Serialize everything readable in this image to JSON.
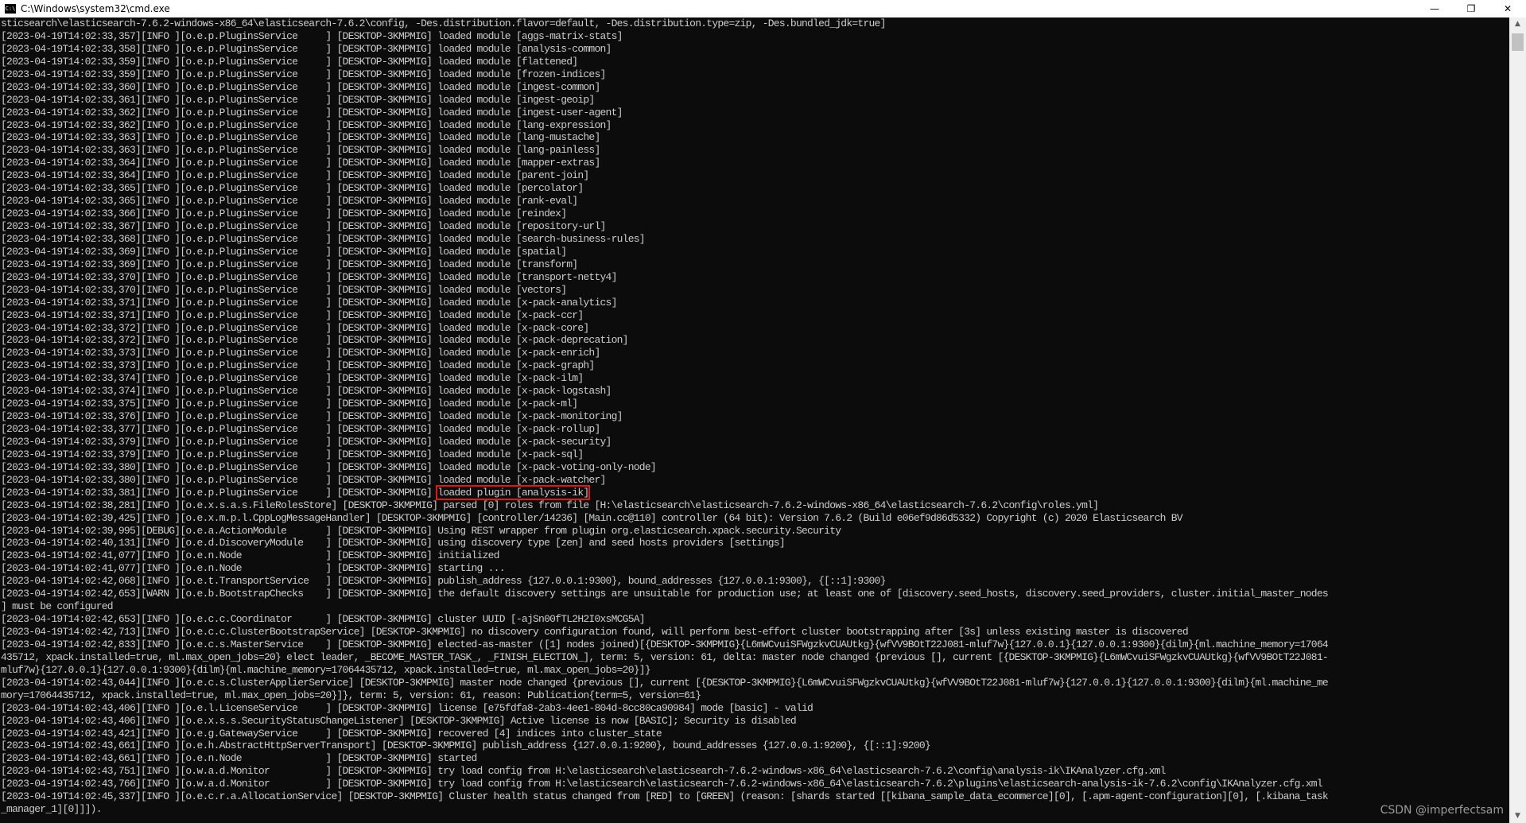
{
  "window": {
    "title": "C:\\Windows\\system32\\cmd.exe",
    "icon": "C:\\",
    "buttons": {
      "minimize": "—",
      "restore": "❐",
      "close": "✕"
    }
  },
  "console": {
    "highlight_text": "loaded plugin [analysis-ik]",
    "lines": [
      "sticsearch\\elasticsearch-7.6.2-windows-x86_64\\elasticsearch-7.6.2\\config, -Des.distribution.flavor=default, -Des.distribution.type=zip, -Des.bundled_jdk=true]",
      "[2023-04-19T14:02:33,357][INFO ][o.e.p.PluginsService     ] [DESKTOP-3KMPMIG] loaded module [aggs-matrix-stats]",
      "[2023-04-19T14:02:33,358][INFO ][o.e.p.PluginsService     ] [DESKTOP-3KMPMIG] loaded module [analysis-common]",
      "[2023-04-19T14:02:33,359][INFO ][o.e.p.PluginsService     ] [DESKTOP-3KMPMIG] loaded module [flattened]",
      "[2023-04-19T14:02:33,359][INFO ][o.e.p.PluginsService     ] [DESKTOP-3KMPMIG] loaded module [frozen-indices]",
      "[2023-04-19T14:02:33,360][INFO ][o.e.p.PluginsService     ] [DESKTOP-3KMPMIG] loaded module [ingest-common]",
      "[2023-04-19T14:02:33,361][INFO ][o.e.p.PluginsService     ] [DESKTOP-3KMPMIG] loaded module [ingest-geoip]",
      "[2023-04-19T14:02:33,362][INFO ][o.e.p.PluginsService     ] [DESKTOP-3KMPMIG] loaded module [ingest-user-agent]",
      "[2023-04-19T14:02:33,362][INFO ][o.e.p.PluginsService     ] [DESKTOP-3KMPMIG] loaded module [lang-expression]",
      "[2023-04-19T14:02:33,363][INFO ][o.e.p.PluginsService     ] [DESKTOP-3KMPMIG] loaded module [lang-mustache]",
      "[2023-04-19T14:02:33,363][INFO ][o.e.p.PluginsService     ] [DESKTOP-3KMPMIG] loaded module [lang-painless]",
      "[2023-04-19T14:02:33,364][INFO ][o.e.p.PluginsService     ] [DESKTOP-3KMPMIG] loaded module [mapper-extras]",
      "[2023-04-19T14:02:33,364][INFO ][o.e.p.PluginsService     ] [DESKTOP-3KMPMIG] loaded module [parent-join]",
      "[2023-04-19T14:02:33,365][INFO ][o.e.p.PluginsService     ] [DESKTOP-3KMPMIG] loaded module [percolator]",
      "[2023-04-19T14:02:33,365][INFO ][o.e.p.PluginsService     ] [DESKTOP-3KMPMIG] loaded module [rank-eval]",
      "[2023-04-19T14:02:33,366][INFO ][o.e.p.PluginsService     ] [DESKTOP-3KMPMIG] loaded module [reindex]",
      "[2023-04-19T14:02:33,367][INFO ][o.e.p.PluginsService     ] [DESKTOP-3KMPMIG] loaded module [repository-url]",
      "[2023-04-19T14:02:33,368][INFO ][o.e.p.PluginsService     ] [DESKTOP-3KMPMIG] loaded module [search-business-rules]",
      "[2023-04-19T14:02:33,369][INFO ][o.e.p.PluginsService     ] [DESKTOP-3KMPMIG] loaded module [spatial]",
      "[2023-04-19T14:02:33,369][INFO ][o.e.p.PluginsService     ] [DESKTOP-3KMPMIG] loaded module [transform]",
      "[2023-04-19T14:02:33,370][INFO ][o.e.p.PluginsService     ] [DESKTOP-3KMPMIG] loaded module [transport-netty4]",
      "[2023-04-19T14:02:33,370][INFO ][o.e.p.PluginsService     ] [DESKTOP-3KMPMIG] loaded module [vectors]",
      "[2023-04-19T14:02:33,371][INFO ][o.e.p.PluginsService     ] [DESKTOP-3KMPMIG] loaded module [x-pack-analytics]",
      "[2023-04-19T14:02:33,371][INFO ][o.e.p.PluginsService     ] [DESKTOP-3KMPMIG] loaded module [x-pack-ccr]",
      "[2023-04-19T14:02:33,372][INFO ][o.e.p.PluginsService     ] [DESKTOP-3KMPMIG] loaded module [x-pack-core]",
      "[2023-04-19T14:02:33,372][INFO ][o.e.p.PluginsService     ] [DESKTOP-3KMPMIG] loaded module [x-pack-deprecation]",
      "[2023-04-19T14:02:33,373][INFO ][o.e.p.PluginsService     ] [DESKTOP-3KMPMIG] loaded module [x-pack-enrich]",
      "[2023-04-19T14:02:33,373][INFO ][o.e.p.PluginsService     ] [DESKTOP-3KMPMIG] loaded module [x-pack-graph]",
      "[2023-04-19T14:02:33,374][INFO ][o.e.p.PluginsService     ] [DESKTOP-3KMPMIG] loaded module [x-pack-ilm]",
      "[2023-04-19T14:02:33,374][INFO ][o.e.p.PluginsService     ] [DESKTOP-3KMPMIG] loaded module [x-pack-logstash]",
      "[2023-04-19T14:02:33,375][INFO ][o.e.p.PluginsService     ] [DESKTOP-3KMPMIG] loaded module [x-pack-ml]",
      "[2023-04-19T14:02:33,376][INFO ][o.e.p.PluginsService     ] [DESKTOP-3KMPMIG] loaded module [x-pack-monitoring]",
      "[2023-04-19T14:02:33,377][INFO ][o.e.p.PluginsService     ] [DESKTOP-3KMPMIG] loaded module [x-pack-rollup]",
      "[2023-04-19T14:02:33,379][INFO ][o.e.p.PluginsService     ] [DESKTOP-3KMPMIG] loaded module [x-pack-security]",
      "[2023-04-19T14:02:33,379][INFO ][o.e.p.PluginsService     ] [DESKTOP-3KMPMIG] loaded module [x-pack-sql]",
      "[2023-04-19T14:02:33,380][INFO ][o.e.p.PluginsService     ] [DESKTOP-3KMPMIG] loaded module [x-pack-voting-only-node]",
      "[2023-04-19T14:02:33,380][INFO ][o.e.p.PluginsService     ] [DESKTOP-3KMPMIG] loaded module [x-pack-watcher]",
      "[2023-04-19T14:02:33,381][INFO ][o.e.p.PluginsService     ] [DESKTOP-3KMPMIG] loaded plugin [analysis-ik]",
      "[2023-04-19T14:02:38,281][INFO ][o.e.x.s.a.s.FileRolesStore] [DESKTOP-3KMPMIG] parsed [0] roles from file [H:\\elasticsearch\\elasticsearch-7.6.2-windows-x86_64\\elasticsearch-7.6.2\\config\\roles.yml]",
      "[2023-04-19T14:02:39,425][INFO ][o.e.x.m.p.l.CppLogMessageHandler] [DESKTOP-3KMPMIG] [controller/14236] [Main.cc@110] controller (64 bit): Version 7.6.2 (Build e06ef9d86d5332) Copyright (c) 2020 Elasticsearch BV",
      "[2023-04-19T14:02:39,995][DEBUG][o.e.a.ActionModule       ] [DESKTOP-3KMPMIG] Using REST wrapper from plugin org.elasticsearch.xpack.security.Security",
      "[2023-04-19T14:02:40,131][INFO ][o.e.d.DiscoveryModule    ] [DESKTOP-3KMPMIG] using discovery type [zen] and seed hosts providers [settings]",
      "[2023-04-19T14:02:41,077][INFO ][o.e.n.Node               ] [DESKTOP-3KMPMIG] initialized",
      "[2023-04-19T14:02:41,077][INFO ][o.e.n.Node               ] [DESKTOP-3KMPMIG] starting ...",
      "[2023-04-19T14:02:42,068][INFO ][o.e.t.TransportService   ] [DESKTOP-3KMPMIG] publish_address {127.0.0.1:9300}, bound_addresses {127.0.0.1:9300}, {[::1]:9300}",
      "[2023-04-19T14:02:42,653][WARN ][o.e.b.BootstrapChecks    ] [DESKTOP-3KMPMIG] the default discovery settings are unsuitable for production use; at least one of [discovery.seed_hosts, discovery.seed_providers, cluster.initial_master_nodes",
      "] must be configured",
      "[2023-04-19T14:02:42,653][INFO ][o.e.c.c.Coordinator      ] [DESKTOP-3KMPMIG] cluster UUID [-ajSn00fTL2H2I0xsMCG5A]",
      "[2023-04-19T14:02:42,713][INFO ][o.e.c.c.ClusterBootstrapService] [DESKTOP-3KMPMIG] no discovery configuration found, will perform best-effort cluster bootstrapping after [3s] unless existing master is discovered",
      "[2023-04-19T14:02:42,833][INFO ][o.e.c.s.MasterService    ] [DESKTOP-3KMPMIG] elected-as-master ([1] nodes joined)[{DESKTOP-3KMPMIG}{L6mWCvuiSFWgzkvCUAUtkg}{wfVV9BOtT22J081-mluf7w}{127.0.0.1}{127.0.0.1:9300}{dilm}{ml.machine_memory=17064",
      "435712, xpack.installed=true, ml.max_open_jobs=20} elect leader, _BECOME_MASTER_TASK_, _FINISH_ELECTION_], term: 5, version: 61, delta: master node changed {previous [], current [{DESKTOP-3KMPMIG}{L6mWCvuiSFWgzkvCUAUtkg}{wfVV9BOtT22J081-",
      "mluf7w}{127.0.0.1}{127.0.0.1:9300}{dilm}{ml.machine_memory=17064435712, xpack.installed=true, ml.max_open_jobs=20}]}",
      "[2023-04-19T14:02:43,044][INFO ][o.e.c.s.ClusterApplierService] [DESKTOP-3KMPMIG] master node changed {previous [], current [{DESKTOP-3KMPMIG}{L6mWCvuiSFWgzkvCUAUtkg}{wfVV9BOtT22J081-mluf7w}{127.0.0.1}{127.0.0.1:9300}{dilm}{ml.machine_me",
      "mory=17064435712, xpack.installed=true, ml.max_open_jobs=20}]}, term: 5, version: 61, reason: Publication{term=5, version=61}",
      "[2023-04-19T14:02:43,406][INFO ][o.e.l.LicenseService     ] [DESKTOP-3KMPMIG] license [e75fdfa8-2ab3-4ee1-804d-8cc80ca90984] mode [basic] - valid",
      "[2023-04-19T14:02:43,406][INFO ][o.e.x.s.s.SecurityStatusChangeListener] [DESKTOP-3KMPMIG] Active license is now [BASIC]; Security is disabled",
      "[2023-04-19T14:02:43,421][INFO ][o.e.g.GatewayService     ] [DESKTOP-3KMPMIG] recovered [4] indices into cluster_state",
      "[2023-04-19T14:02:43,661][INFO ][o.e.h.AbstractHttpServerTransport] [DESKTOP-3KMPMIG] publish_address {127.0.0.1:9200}, bound_addresses {127.0.0.1:9200}, {[::1]:9200}",
      "[2023-04-19T14:02:43,661][INFO ][o.e.n.Node               ] [DESKTOP-3KMPMIG] started",
      "[2023-04-19T14:02:43,751][INFO ][o.w.a.d.Monitor          ] [DESKTOP-3KMPMIG] try load config from H:\\elasticsearch\\elasticsearch-7.6.2-windows-x86_64\\elasticsearch-7.6.2\\config\\analysis-ik\\IKAnalyzer.cfg.xml",
      "[2023-04-19T14:02:43,766][INFO ][o.w.a.d.Monitor          ] [DESKTOP-3KMPMIG] try load config from H:\\elasticsearch\\elasticsearch-7.6.2-windows-x86_64\\elasticsearch-7.6.2\\plugins\\elasticsearch-analysis-ik-7.6.2\\config\\IKAnalyzer.cfg.xml",
      "[2023-04-19T14:02:45,337][INFO ][o.e.c.r.a.AllocationService] [DESKTOP-3KMPMIG] Cluster health status changed from [RED] to [GREEN] (reason: [shards started [[kibana_sample_data_ecommerce][0], [.apm-agent-configuration][0], [.kibana_task",
      "_manager_1][0]]]).",
      ""
    ]
  },
  "watermark": "CSDN @imperfectsam"
}
